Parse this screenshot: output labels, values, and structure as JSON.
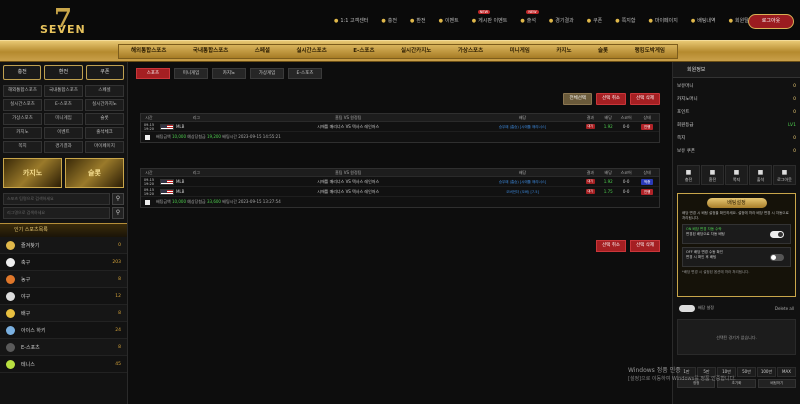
{
  "header": {
    "logo_number": "7",
    "logo_text": "SEVEN",
    "nav": [
      {
        "label": "1:1 고객센터",
        "badge": ""
      },
      {
        "label": "충전",
        "badge": ""
      },
      {
        "label": "환전",
        "badge": ""
      },
      {
        "label": "이벤트",
        "badge": ""
      },
      {
        "label": "게시판 이벤트",
        "badge": "NEW"
      },
      {
        "label": "출석",
        "badge": "NEW"
      },
      {
        "label": "경기결과",
        "badge": ""
      },
      {
        "label": "쿠폰",
        "badge": ""
      },
      {
        "label": "쪽지함",
        "badge": ""
      },
      {
        "label": "마이페이지",
        "badge": ""
      },
      {
        "label": "배팅내역",
        "badge": ""
      },
      {
        "label": "회원탈퇴",
        "badge": ""
      }
    ],
    "login_label": "로그아웃"
  },
  "main_nav": [
    "해외통합스포츠",
    "국내통합스포츠",
    "스페셜",
    "실시간스포츠",
    "E-스포츠",
    "실시간카지노",
    "가상스포츠",
    "미니게임",
    "카지노",
    "슬롯",
    "랭킹도박게임"
  ],
  "left": {
    "top_buttons": [
      "충전",
      "환전",
      "쿠폰"
    ],
    "grid": [
      "해외통합스포츠",
      "국내통합스포츠",
      "스페셜",
      "실시간스포츠",
      "E-스포츠",
      "실시간카지노",
      "가상스포츠",
      "미니게임",
      "슬롯",
      "카지노",
      "이벤트",
      "출석체크",
      "쪽지",
      "경기결과",
      "마이페이지"
    ],
    "banners": [
      "카지노",
      "슬롯"
    ],
    "search_placeholder": "스포츠 팀명으로 검색하세요",
    "search_placeholder2": "리그명으로 검색하세요",
    "sports_header": "인기 스포츠목록",
    "sports": [
      {
        "name": "즐겨찾기",
        "count": "0",
        "color": "#e0b84a"
      },
      {
        "name": "축구",
        "count": "203",
        "color": "#eeeeee"
      },
      {
        "name": "농구",
        "count": "8",
        "color": "#e0772a"
      },
      {
        "name": "야구",
        "count": "12",
        "color": "#dddddd"
      },
      {
        "name": "배구",
        "count": "8",
        "color": "#e8c040"
      },
      {
        "name": "아이스 하키",
        "count": "24",
        "color": "#7ab0e0"
      },
      {
        "name": "E-스포츠",
        "count": "8",
        "color": "#5a5a5a"
      },
      {
        "name": "테니스",
        "count": "45",
        "color": "#b8e040"
      }
    ]
  },
  "center": {
    "tabs": [
      "스포츠",
      "미니게임",
      "카지노",
      "가상게임",
      "E-스포츠"
    ],
    "actions": [
      {
        "label": "전체선택",
        "style": "gray"
      },
      {
        "label": "선택 취소",
        "style": "red"
      },
      {
        "label": "선택 삭제",
        "style": "red"
      }
    ],
    "headers": {
      "time": "시간",
      "league": "리그",
      "game": "홈팀 VS 원정팀",
      "pick": "배당",
      "result": "결과",
      "odd": "배당",
      "score": "스코어",
      "status": "상태"
    },
    "slips": [
      {
        "rows": [
          {
            "time": "09-15 19:20",
            "league": "MLB",
            "game": "시애틀 매리너스 VS 텍사스 레인저스",
            "pick": "승무패 (홈승) [시애틀 매리너스]",
            "result": "대기",
            "odd": "1.92",
            "score": "0-0",
            "status": "진행",
            "status_style": "red"
          }
        ],
        "summary": {
          "amount_label": "배팅금액",
          "amount": "10,000",
          "win_label": "예상당첨금",
          "win": "19,200",
          "date_label": "배팅시간",
          "date": "2023-09-15 14:55:21"
        }
      },
      {
        "rows": [
          {
            "time": "09-15 19:20",
            "league": "MLB",
            "game": "시애틀 매리너스 VS 텍사스 레인저스",
            "pick": "승무패 (홈승) [시애틀 매리너스]",
            "result": "대기",
            "odd": "1.92",
            "score": "0-0",
            "status": "적중",
            "status_style": "blue"
          },
          {
            "time": "09-15 19:20",
            "league": "MLB",
            "game": "시애틀 매리너스 VS 텍사스 레인저스",
            "pick": "오버언더 (오버) [7.5]",
            "result": "대기",
            "odd": "1.75",
            "score": "0-0",
            "status": "진행",
            "status_style": "red"
          }
        ],
        "summary": {
          "amount_label": "배팅금액",
          "amount": "10,000",
          "win_label": "예상당첨금",
          "win": "33,600",
          "date_label": "배팅시간",
          "date": "2023-09-15 13:27:54"
        }
      }
    ],
    "bottom_actions": [
      "선택 취소",
      "선택 삭제"
    ]
  },
  "right": {
    "title": "회원정보",
    "info": [
      {
        "k": "보유머니",
        "v": "0",
        "cls": "v"
      },
      {
        "k": "카지노머니",
        "v": "0",
        "cls": "v"
      },
      {
        "k": "포인트",
        "v": "0",
        "cls": "v"
      },
      {
        "k": "회원등급",
        "v": "LV1",
        "cls": "g"
      },
      {
        "k": "쪽지",
        "v": "0",
        "cls": "v"
      },
      {
        "k": "보유 쿠폰",
        "v": "0",
        "cls": "v"
      }
    ],
    "icons": [
      "충전",
      "환전",
      "쪽지",
      "출석",
      "로그아웃"
    ],
    "betset": {
      "title": "배팅설정",
      "desc": "배당 변경 시 배팅 설정을 확인하세요. 설정에 따라 배당 변경 시 자동으로 처리됩니다.",
      "opt_on_title": "ON 배당 변경 자동 수락",
      "opt_on_desc": "변경된 배당으로 자동 배팅",
      "opt_off_title": "OFF 배당 변경 수동 확인",
      "opt_off_desc": "변경 시 확인 후 배팅",
      "note": "*배당 변경 시 설정된 옵션에 따라 처리됩니다."
    },
    "toggle_label": "배당 설정",
    "toggle_extra": "Delete all",
    "empty": "선택된 경기가 없습니다.",
    "pad": [
      "1만",
      "5만",
      "10만",
      "50만",
      "100만",
      "MAX"
    ],
    "pad_bottom": [
      "정정",
      "초기화",
      "배팅하기"
    ]
  },
  "watermark": {
    "line1": "Windows 정품 인증",
    "line2": "[설정]으로 이동하여 Windows를 정품 인증합니다."
  }
}
